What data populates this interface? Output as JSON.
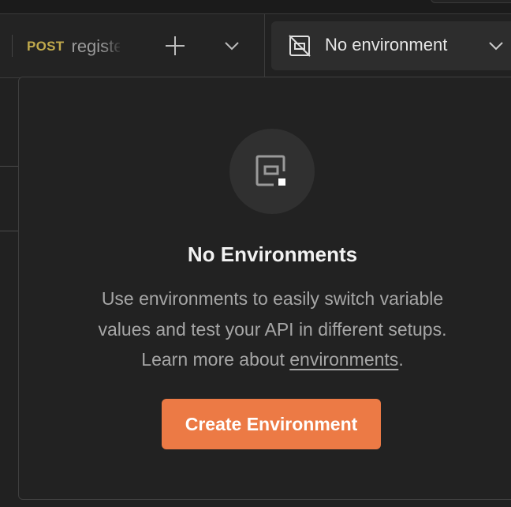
{
  "colors": {
    "background": "#212121",
    "method_post": "#c0a94c",
    "accent_button": "#ec7a45",
    "title_text": "#f2f2f2",
    "muted_text": "#a6a6a6"
  },
  "tabbar": {
    "active_tab": {
      "method": "POST",
      "name": "register"
    },
    "icons": {
      "add_tab": "plus-icon",
      "tabs_menu": "chevron-down-icon"
    }
  },
  "environment_selector": {
    "icon": "environment-off-icon",
    "label": "No environment",
    "chevron": "chevron-down-icon"
  },
  "popover": {
    "icon": "environment-icon",
    "title": "No Environments",
    "description_line1": "Use environments to easily switch variable",
    "description_line2": "values and test your API in different setups.",
    "description_line3_prefix": "Learn more about ",
    "description_link": "environments",
    "description_line3_suffix": ".",
    "create_button_label": "Create Environment"
  }
}
